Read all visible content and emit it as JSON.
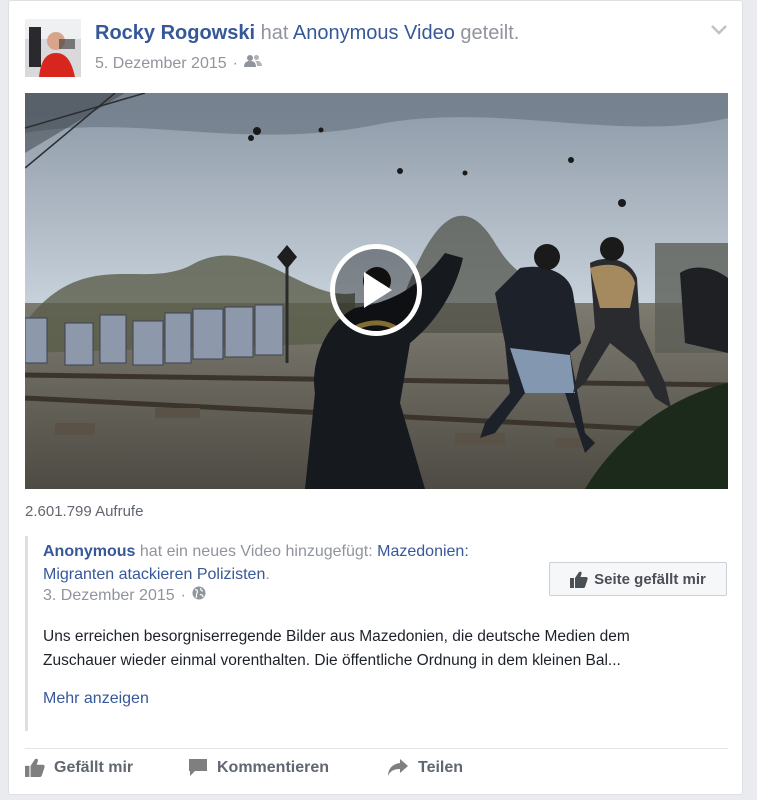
{
  "post": {
    "author": "Rocky Rogowski",
    "verb": "hat",
    "shared_page": "Anonymous Video",
    "shared_suffix": "geteilt.",
    "date": "5. Dezember 2015",
    "separator": "·",
    "audience_icon": "friends-icon",
    "menu_icon": "chevron-down-icon"
  },
  "video": {
    "play_icon": "play-icon",
    "views": "2.601.799 Aufrufe"
  },
  "shared": {
    "author": "Anonymous",
    "action_text": "hat ein neues Video hinzugefügt:",
    "video_title": "Mazedonien: Migranten atackieren Polizisten",
    "title_end": ".",
    "date": "3. Dezember 2015",
    "separator": "·",
    "audience_icon": "globe-icon",
    "like_page_label": "Seite gefällt mir",
    "description_line1": "Uns erreichen besorgniserregende Bilder aus Mazedonien, die deutsche Medien dem",
    "description_line2": "Zuschauer wieder einmal vorenthalten. Die öffentliche Ordnung in dem kleinen Bal...",
    "more_label": "Mehr anzeigen"
  },
  "actions": {
    "like_label": "Gefällt mir",
    "comment_label": "Kommentieren",
    "share_label": "Teilen"
  },
  "colors": {
    "link": "#365899",
    "muted": "#90949c",
    "action": "#606770"
  }
}
